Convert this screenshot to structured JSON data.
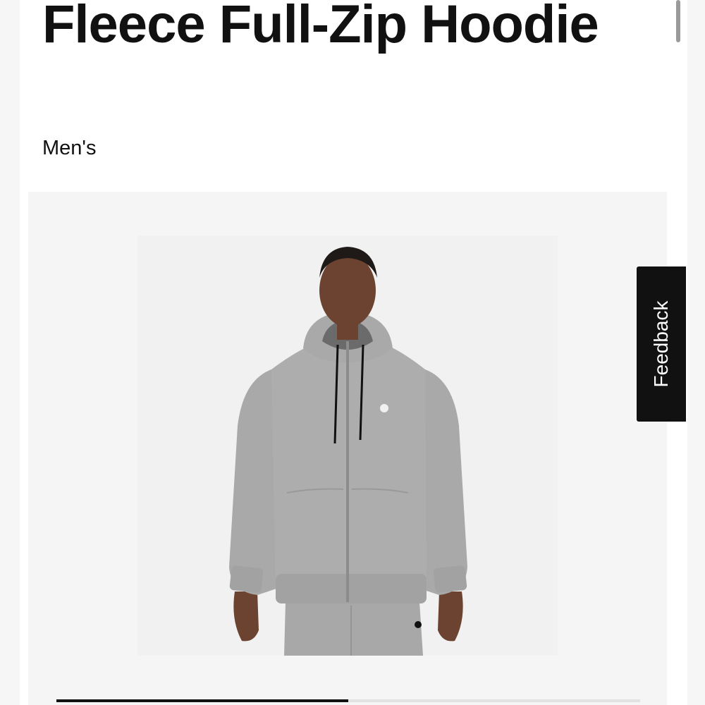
{
  "product": {
    "title": "Fleece Full-Zip Hoodie",
    "subtitle": "Men's"
  },
  "gallery": {
    "image_icon": "hoodie-product-photo",
    "carousel_progress": 0.5
  },
  "feedback": {
    "label": "Feedback"
  },
  "colors": {
    "text": "#111111",
    "gallery_bg": "#f5f5f5",
    "hoodie_grey": "#a9a9a9",
    "feedback_bg": "#111111"
  }
}
